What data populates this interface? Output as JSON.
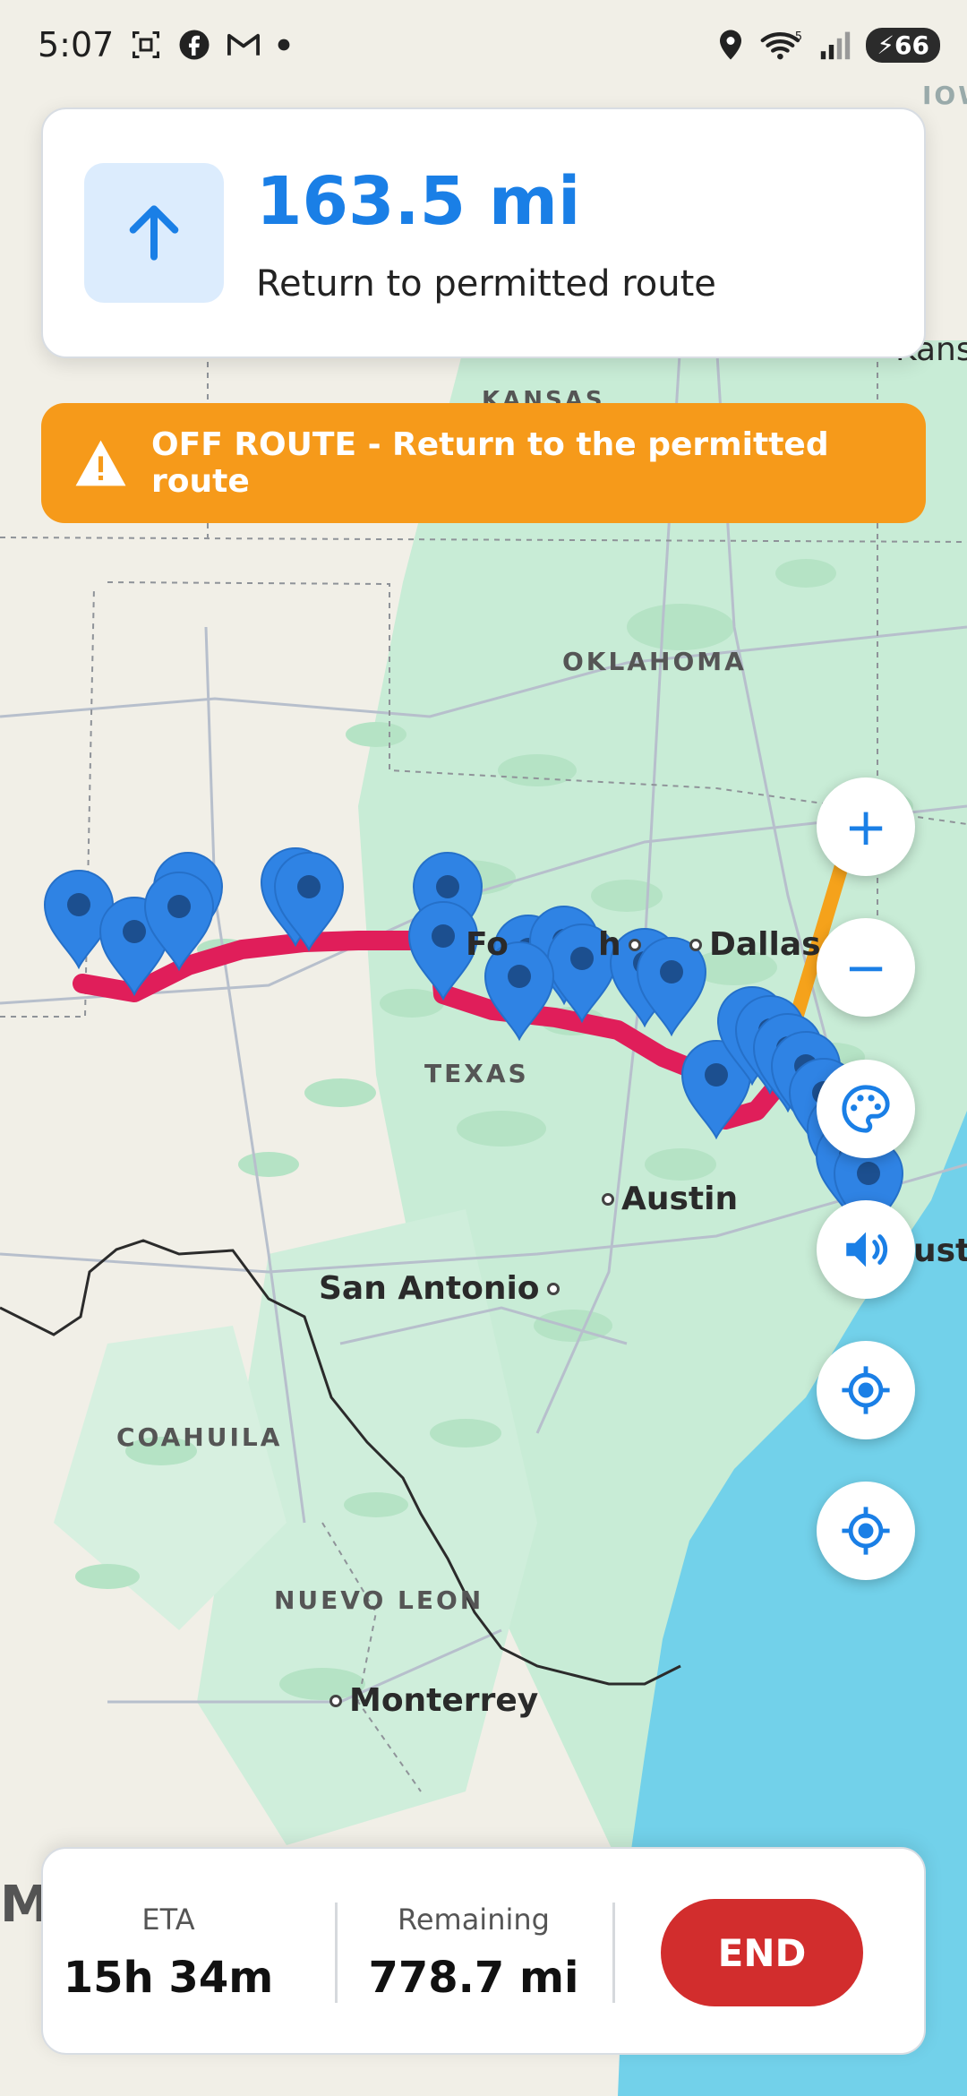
{
  "status_bar": {
    "time": "5:07",
    "notification_icons": [
      "screenshot-icon",
      "facebook-icon",
      "gmail-icon",
      "dot-icon"
    ],
    "system_icons": [
      "location-icon",
      "wifi-icon",
      "signal-icon"
    ],
    "battery": "66",
    "wifi_badge": "5"
  },
  "navigation": {
    "distance": "163.5 mi",
    "instruction": "Return to permitted route",
    "arrow_icon": "arrow-up-icon"
  },
  "alert": {
    "text": "OFF ROUTE - Return to the permitted route",
    "icon": "warning-icon"
  },
  "map": {
    "regions": [
      "KANSAS",
      "OKLAHOMA",
      "TEXAS",
      "COAHUILA",
      "NUEVO LEON"
    ],
    "cities": [
      "Dallas",
      "Austin",
      "San Antonio",
      "Monterrey"
    ],
    "partial_labels": [
      "Fo",
      "h",
      "ust",
      "Kansa",
      "IOW",
      "M"
    ],
    "route_color": "#e01e5a",
    "deviation_color": "#f5a21b",
    "marker_color": "#2f83e4",
    "water_color": "#72d1ea"
  },
  "controls": {
    "zoom_in": "+",
    "zoom_out": "−",
    "icons": [
      "palette-icon",
      "volume-icon",
      "recenter-icon",
      "my-location-icon"
    ]
  },
  "trip": {
    "eta_label": "ETA",
    "eta_value": "15h 34m",
    "remaining_label": "Remaining",
    "remaining_value": "778.7 mi",
    "end_label": "END"
  },
  "colors": {
    "accent": "#1a7fe6",
    "alert": "#f69a1a",
    "end_button": "#d22d2d"
  }
}
